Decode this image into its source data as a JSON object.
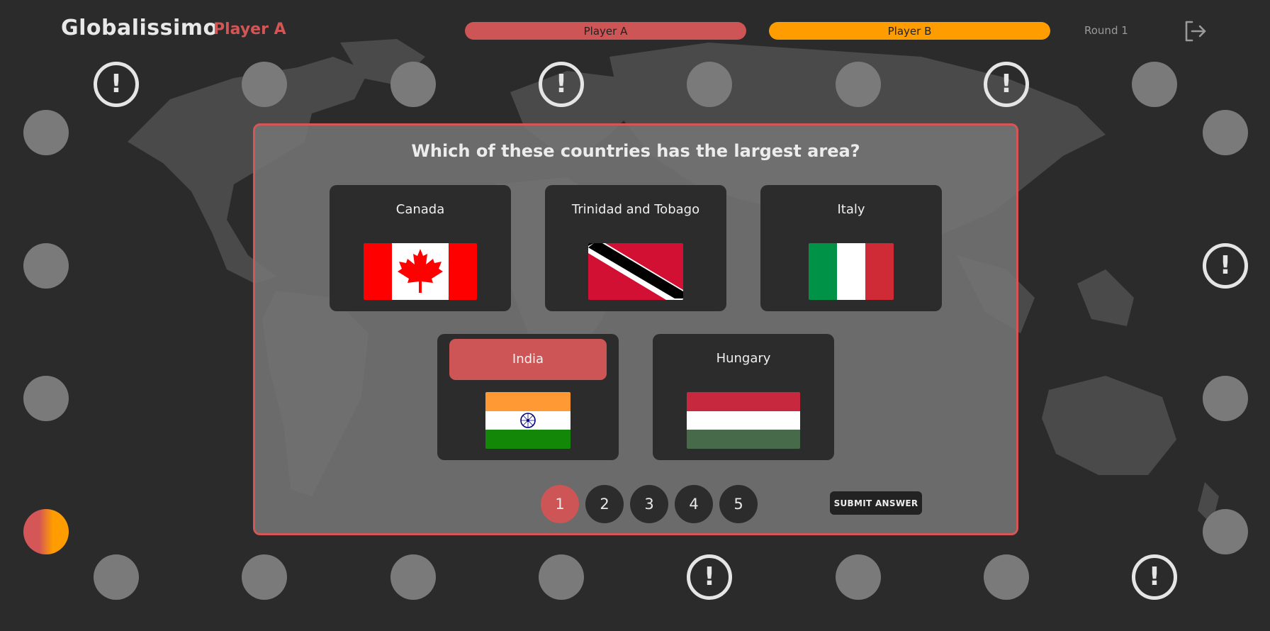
{
  "header": {
    "app_title": "Globalissimo",
    "current_player": "Player A",
    "players": [
      {
        "name": "Player A",
        "color": "#cd5555"
      },
      {
        "name": "Player B",
        "color": "#ff9d00"
      }
    ],
    "round_label": "Round 1",
    "logout_icon": "logout-icon"
  },
  "board": {
    "space_icons": {
      "alert": "exclamation-icon"
    }
  },
  "quiz": {
    "question": "Which of these countries has the largest area?",
    "options": [
      {
        "label": "Canada",
        "flag": "canada-flag"
      },
      {
        "label": "Trinidad and Tobago",
        "flag": "trinidad-and-tobago-flag"
      },
      {
        "label": "Italy",
        "flag": "italy-flag"
      },
      {
        "label": "India",
        "flag": "india-flag",
        "selected": true
      },
      {
        "label": "Hungary",
        "flag": "hungary-flag"
      }
    ],
    "pages": [
      "1",
      "2",
      "3",
      "4",
      "5"
    ],
    "active_page": "1",
    "submit_label": "SUBMIT ANSWER"
  },
  "colors": {
    "accent_red": "#cd5555",
    "accent_orange": "#ff9d00",
    "background": "#2b2b2b"
  }
}
